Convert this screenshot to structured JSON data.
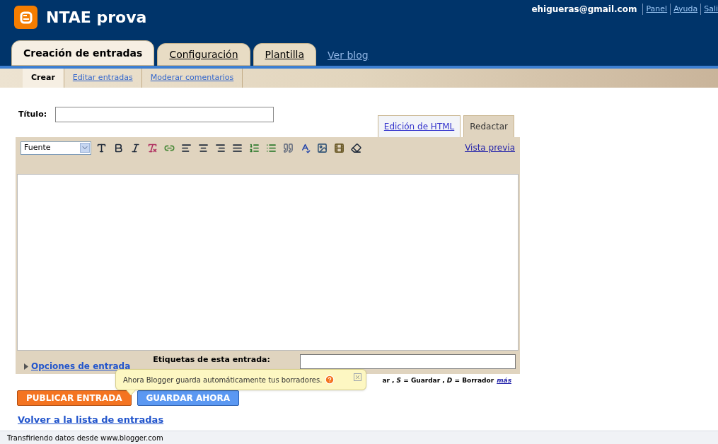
{
  "header": {
    "blog_title": "NTAE prova",
    "user_email": "ehigueras@gmail.com",
    "links": [
      "Panel",
      "Ayuda",
      "Sali"
    ]
  },
  "tabs": [
    {
      "label": "Creación de entradas",
      "selected": true,
      "kind": "tab"
    },
    {
      "label": "Configuración",
      "selected": false,
      "kind": "tab"
    },
    {
      "label": "Plantilla",
      "selected": false,
      "kind": "tab"
    },
    {
      "label": "Ver blog",
      "selected": false,
      "kind": "link"
    }
  ],
  "subtabs": [
    {
      "label": "Crear",
      "selected": true
    },
    {
      "label": "Editar entradas",
      "selected": false
    },
    {
      "label": "Moderar comentarios",
      "selected": false
    }
  ],
  "title_field": {
    "label": "Título:"
  },
  "editor_modes": [
    {
      "label": "Edición de HTML",
      "selected": false
    },
    {
      "label": "Redactar",
      "selected": true
    }
  ],
  "toolbar": {
    "font_select": "Fuente",
    "preview_link": "Vista previa"
  },
  "post_options": {
    "link": "Opciones de entrada",
    "labels_label": "Etiquetas de esta entrada:"
  },
  "shortcuts": {
    "text": "ar , *S* = **Guardar** , *D* = **Borrador**",
    "more_link": "más"
  },
  "tooltip": {
    "text": "Ahora Blogger guarda automáticamente tus borradores."
  },
  "buttons": [
    "PUBLICAR ENTRADA",
    "GUARDAR AHORA"
  ],
  "back_link": "Volver a la lista de entradas",
  "status_bar": "Transfiriendo datos desde www.blogger.com"
}
